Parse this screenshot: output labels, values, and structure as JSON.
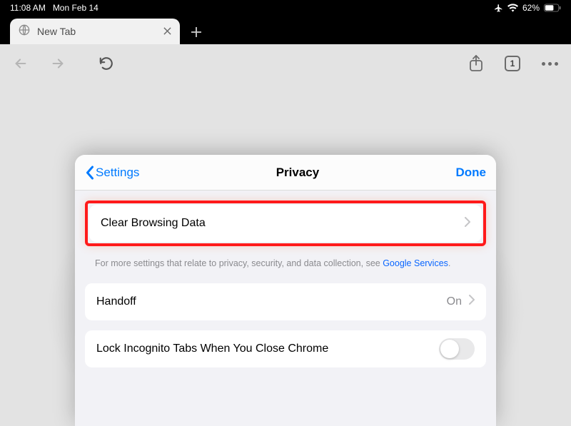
{
  "status": {
    "time": "11:08 AM",
    "date": "Mon Feb 14",
    "battery": "62%"
  },
  "tab": {
    "title": "New Tab"
  },
  "toolbar": {
    "tab_count": "1"
  },
  "sheet": {
    "back_label": "Settings",
    "title": "Privacy",
    "done_label": "Done",
    "rows": {
      "clear_browsing": {
        "label": "Clear Browsing Data"
      },
      "handoff": {
        "label": "Handoff",
        "value": "On"
      },
      "lock_incognito": {
        "label": "Lock Incognito Tabs When You Close Chrome"
      }
    },
    "footer_note_prefix": "For more settings that relate to privacy, security, and data collection, see ",
    "footer_note_link": "Google Services",
    "footer_note_suffix": "."
  }
}
